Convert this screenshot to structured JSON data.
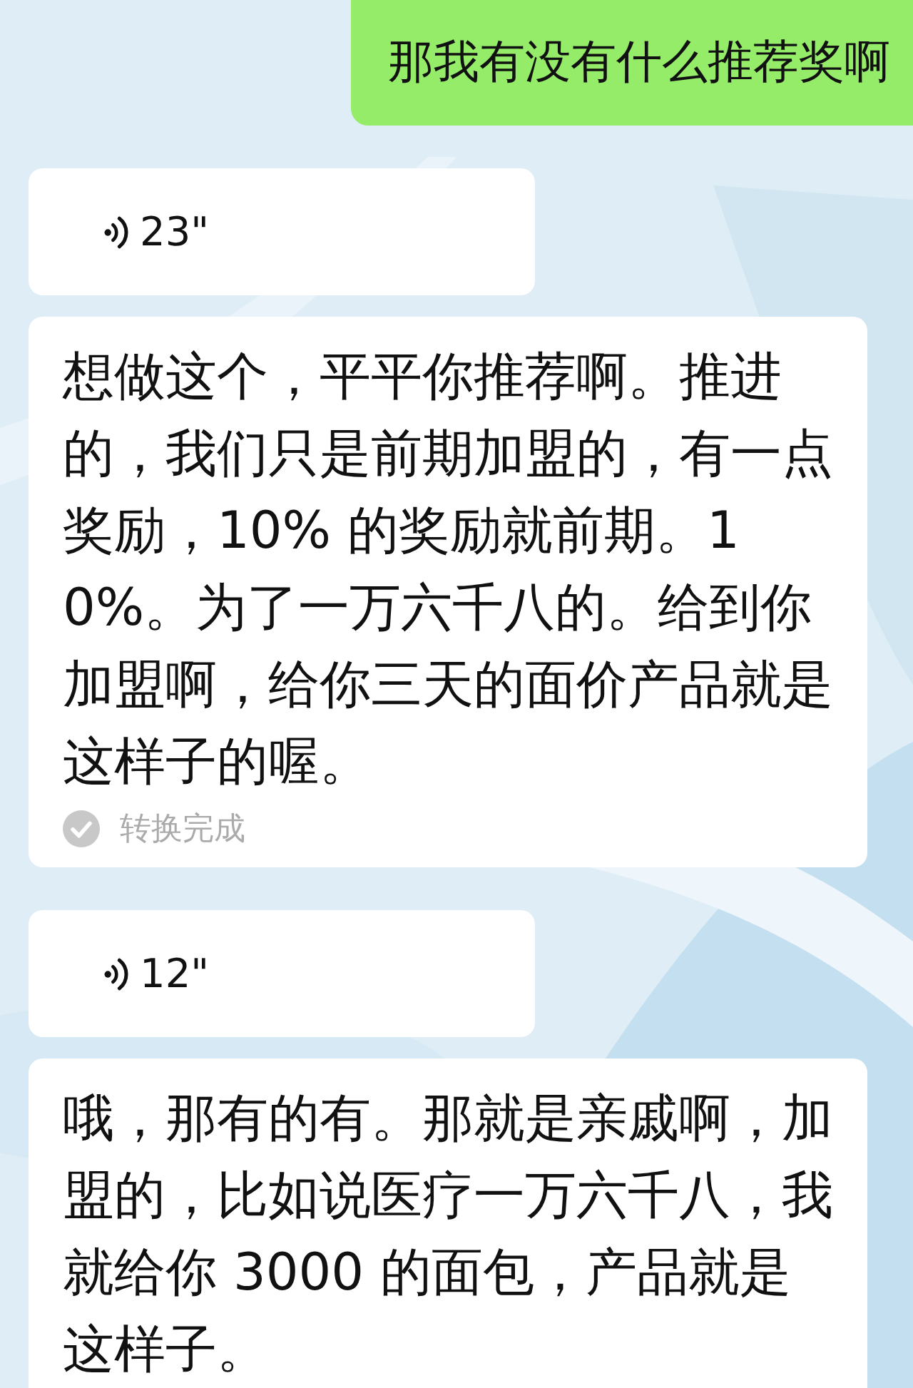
{
  "messages": [
    {
      "kind": "text_out",
      "text": "那我有没有什么推荐奖啊"
    },
    {
      "kind": "voice_in",
      "duration": "23\"",
      "transcript": "想做这个，平平你推荐啊。推进的，我们只是前期加盟的，有一点奖励，10% 的奖励就前期。10%。为了一万六千八的。给到你加盟啊，给你三天的面价产品就是这样子的喔。",
      "status": "转换完成"
    },
    {
      "kind": "voice_in",
      "duration": "12\"",
      "transcript": "哦，那有的有。那就是亲戚啊，加盟的，比如说医疗一万六千八，我就给你 3000 的面包，产品就是这样子。"
    }
  ]
}
